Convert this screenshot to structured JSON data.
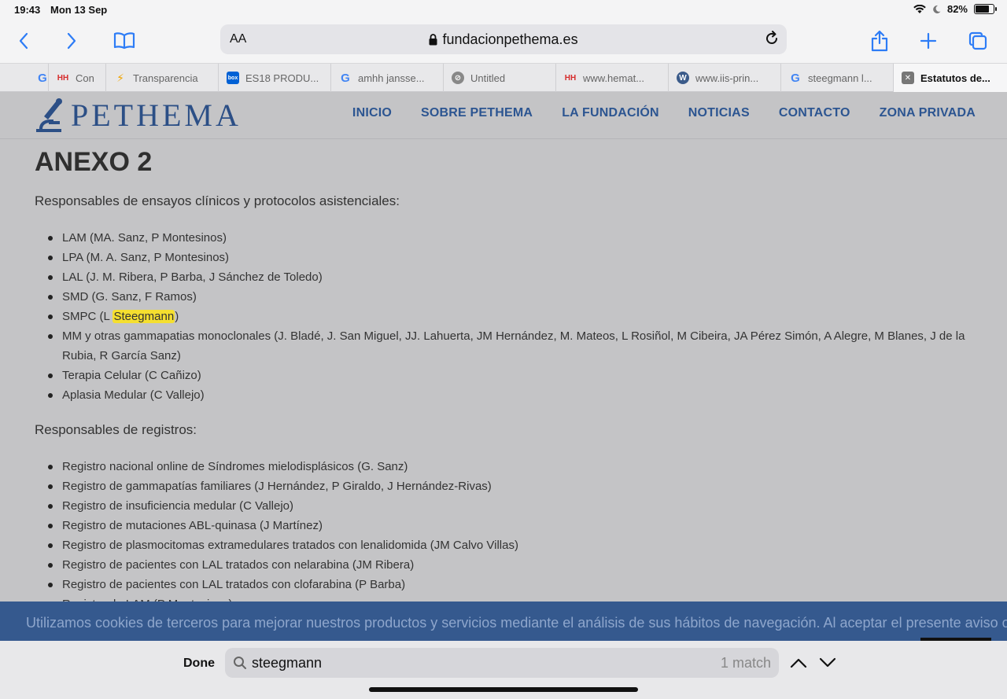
{
  "status": {
    "time": "19:43",
    "date": "Mon 13 Sep",
    "battery": "82%",
    "battery_level": 0.82
  },
  "browser": {
    "aa_label": "AA",
    "url": "fundacionpethema.es",
    "tabs": [
      {
        "label": "",
        "icon": "google-icon"
      },
      {
        "label": "Con",
        "icon": "hh-icon"
      },
      {
        "label": "Transparencia",
        "icon": "bolt-icon"
      },
      {
        "label": "ES18 PRODU...",
        "icon": "box-icon"
      },
      {
        "label": "amhh jansse...",
        "icon": "google-icon"
      },
      {
        "label": "Untitled",
        "icon": "compass-icon"
      },
      {
        "label": "www.hemat...",
        "icon": "hh-icon"
      },
      {
        "label": "www.iis-prin...",
        "icon": "wordpress-icon"
      },
      {
        "label": "steegmann l...",
        "icon": "google-icon"
      },
      {
        "label": "Estatutos de...",
        "icon": "close-icon"
      }
    ]
  },
  "site": {
    "logo": "PETHEMA",
    "nav": [
      "INICIO",
      "SOBRE PETHEMA",
      "LA FUNDACIÓN",
      "NOTICIAS",
      "CONTACTO",
      "ZONA PRIVADA"
    ]
  },
  "content": {
    "heading": "ANEXO 2",
    "section1": "Responsables de ensayos clínicos y protocolos asistenciales:",
    "list1": [
      "LAM (MA. Sanz, P Montesinos)",
      "LPA (M. A. Sanz, P Montesinos)",
      "LAL (J. M. Ribera, P Barba, J Sánchez de Toledo)",
      "SMD (G. Sanz, F Ramos)",
      "MM y otras gammapatias monoclonales (J. Bladé, J. San Miguel, JJ. Lahuerta, JM Hernández, M. Mateos, L Rosiñol, M Cibeira, JA Pérez Simón, A Alegre, M Blanes, J de la Rubia, R García Sanz)",
      "Terapia Celular (C Cañizo)",
      "Aplasia Medular (C Vallejo)"
    ],
    "smpc": {
      "before": "SMPC (L ",
      "highlight": "Steegmann",
      "after": ")"
    },
    "section2": "Responsables de registros:",
    "list2": [
      "Registro nacional online de Síndromes mielodisplásicos (G. Sanz)",
      "Registro de gammapatías familiares (J Hernández, P Giraldo, J Hernández-Rivas)",
      "Registro de insuficiencia medular (C Vallejo)",
      "Registro de mutaciones ABL-quinasa (J Martínez)",
      "Registro de plasmocitomas extramedulares tratados con lenalidomida (JM Calvo Villas)",
      "Registro de pacientes con LAL tratados con nelarabina (JM Ribera)",
      "Registro de pacientes con LAL tratados con clofarabina (P Barba)",
      "Registro de LAM (P Montesinos)"
    ]
  },
  "cookie": "Utilizamos cookies de terceros para mejorar nuestros productos y servicios mediante el análisis de sus hábitos de navegación. Al aceptar el presente aviso o",
  "find": {
    "done": "Done",
    "query": "steegmann",
    "count": "1 match"
  },
  "colors": {
    "accent": "#2d7cf6",
    "nav": "#2c5591",
    "cookie_bg": "#35598e",
    "highlight": "#f5df2f"
  }
}
